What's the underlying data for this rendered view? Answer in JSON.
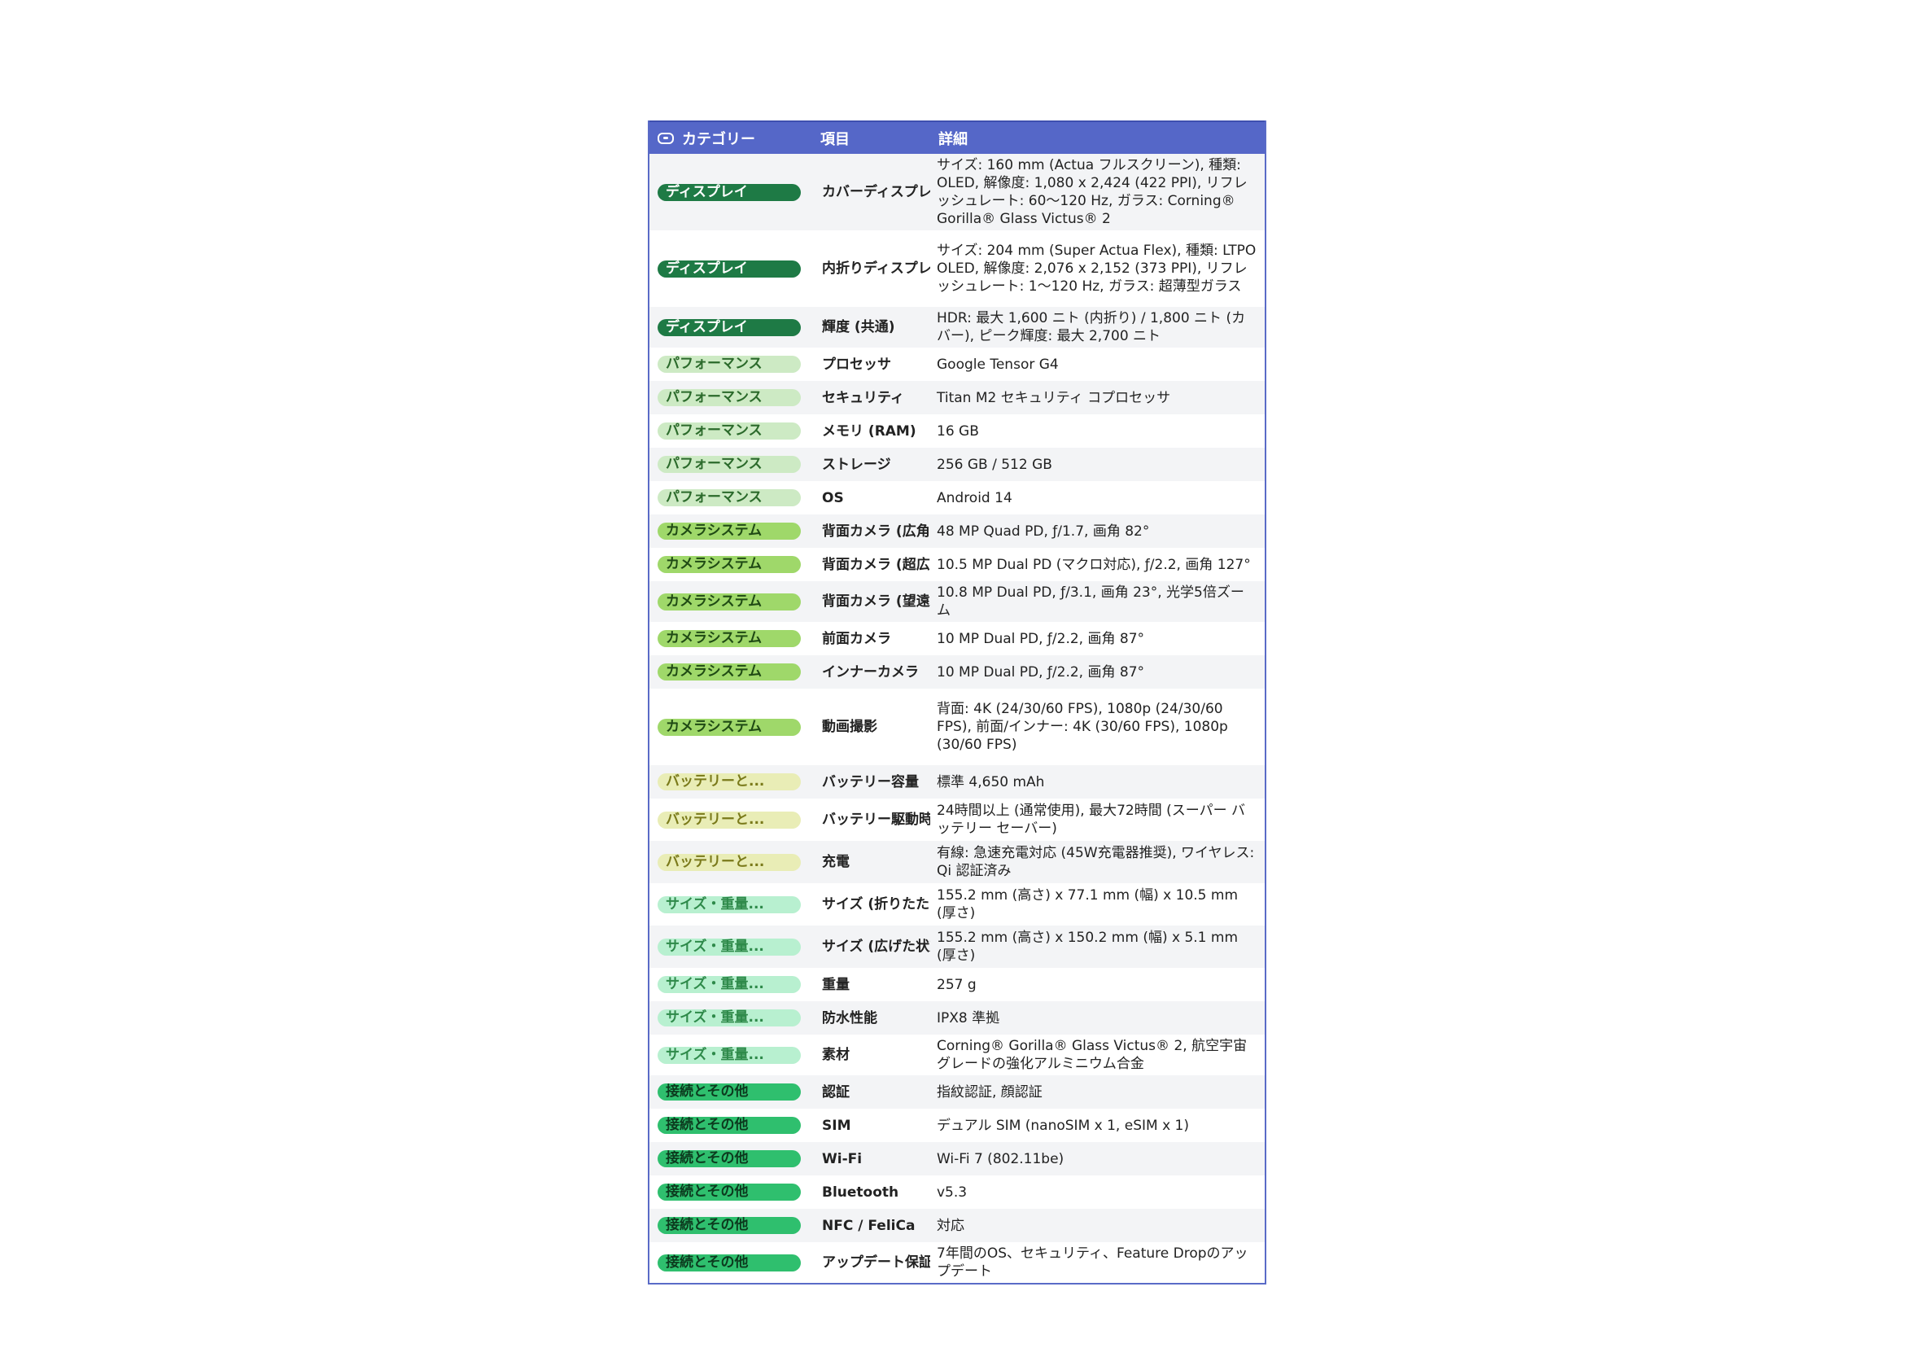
{
  "header": {
    "col_category": "カテゴリー",
    "col_item": "項目",
    "col_detail": "詳細"
  },
  "colors": {
    "header_bg": "#5567c8",
    "display": {
      "bg": "#1e7a45",
      "fg": "#ffffff"
    },
    "performance": {
      "bg": "#cdeac4",
      "fg": "#2b6a2b"
    },
    "camera": {
      "bg": "#9fd86a",
      "fg": "#1f4a14"
    },
    "battery": {
      "bg": "#e9edb6",
      "fg": "#7a7a1a"
    },
    "size": {
      "bg": "#b8f0d0",
      "fg": "#2e8a4a"
    },
    "connect": {
      "bg": "#2fbf6e",
      "fg": "#0c3a1e"
    }
  },
  "rows": [
    {
      "cat": "ディスプレイ",
      "tone": "display",
      "item": "カバーディスプレイ",
      "detail": "サイズ: 160 mm (Actua フルスクリーン), 種類: OLED, 解像度: 1,080 x 2,424 (422 PPI), リフレッシュレート: 60〜120 Hz, ガラス: Corning® Gorilla® Glass Victus® 2",
      "h": "tall-4"
    },
    {
      "cat": "ディスプレイ",
      "tone": "display",
      "item": "内折りディスプレイ",
      "detail": "サイズ: 204 mm (Super Actua Flex), 種類: LTPO OLED, 解像度: 2,076 x 2,152 (373 PPI), リフレッシュレート: 1〜120 Hz, ガラス: 超薄型ガラス",
      "h": "tall-3"
    },
    {
      "cat": "ディスプレイ",
      "tone": "display",
      "item": "輝度 (共通)",
      "detail": "HDR: 最大 1,600 ニト (内折り) / 1,800 ニト (カバー), ピーク輝度: 最大 2,700 ニト",
      "h": "tall-2b"
    },
    {
      "cat": "パフォーマンス",
      "tone": "performance",
      "item": "プロセッサ",
      "detail": "Google Tensor G4",
      "h": ""
    },
    {
      "cat": "パフォーマンス",
      "tone": "performance",
      "item": "セキュリティ",
      "detail": "Titan M2 セキュリティ コプロセッサ",
      "h": ""
    },
    {
      "cat": "パフォーマンス",
      "tone": "performance",
      "item": "メモリ (RAM)",
      "detail": "16 GB",
      "h": ""
    },
    {
      "cat": "パフォーマンス",
      "tone": "performance",
      "item": "ストレージ",
      "detail": "256 GB / 512 GB",
      "h": ""
    },
    {
      "cat": "パフォーマンス",
      "tone": "performance",
      "item": "OS",
      "detail": "Android 14",
      "h": ""
    },
    {
      "cat": "カメラシステム",
      "tone": "camera",
      "item": "背面カメラ (広角)",
      "detail": "48 MP Quad PD, ƒ/1.7, 画角 82°",
      "h": ""
    },
    {
      "cat": "カメラシステム",
      "tone": "camera",
      "item": "背面カメラ (超広角)",
      "detail": "10.5 MP Dual PD (マクロ対応), ƒ/2.2, 画角 127°",
      "h": ""
    },
    {
      "cat": "カメラシステム",
      "tone": "camera",
      "item": "背面カメラ (望遠)",
      "detail": "10.8 MP Dual PD, ƒ/3.1, 画角 23°, 光学5倍ズーム",
      "h": ""
    },
    {
      "cat": "カメラシステム",
      "tone": "camera",
      "item": "前面カメラ",
      "detail": "10 MP Dual PD, ƒ/2.2, 画角 87°",
      "h": ""
    },
    {
      "cat": "カメラシステム",
      "tone": "camera",
      "item": "インナーカメラ",
      "detail": "10 MP Dual PD, ƒ/2.2, 画角 87°",
      "h": ""
    },
    {
      "cat": "カメラシステム",
      "tone": "camera",
      "item": "動画撮影",
      "detail": "背面: 4K (24/30/60 FPS), 1080p (24/30/60 FPS), 前面/インナー: 4K (30/60 FPS), 1080p (30/60 FPS)",
      "h": "tall-4"
    },
    {
      "cat": "バッテリーと...",
      "tone": "battery",
      "item": "バッテリー容量",
      "detail": "標準 4,650 mAh",
      "h": ""
    },
    {
      "cat": "バッテリーと...",
      "tone": "battery",
      "item": "バッテリー駆動時間",
      "detail": "24時間以上 (通常使用), 最大72時間 (スーパー バッテリー セーバー)",
      "h": "tall-2"
    },
    {
      "cat": "バッテリーと...",
      "tone": "battery",
      "item": "充電",
      "detail": "有線: 急速充電対応 (45W充電器推奨), ワイヤレス: Qi 認証済み",
      "h": "tall-2"
    },
    {
      "cat": "サイズ・重量...",
      "tone": "size",
      "item": "サイズ (折りたたみ時)",
      "detail": "155.2 mm (高さ) x 77.1 mm (幅) x 10.5 mm (厚さ)",
      "h": "tall-2"
    },
    {
      "cat": "サイズ・重量...",
      "tone": "size",
      "item": "サイズ (広げた状態)",
      "detail": "155.2 mm (高さ) x 150.2 mm (幅) x 5.1 mm (厚さ)",
      "h": "tall-2"
    },
    {
      "cat": "サイズ・重量...",
      "tone": "size",
      "item": "重量",
      "detail": "257 g",
      "h": ""
    },
    {
      "cat": "サイズ・重量...",
      "tone": "size",
      "item": "防水性能",
      "detail": "IPX8 準拠",
      "h": ""
    },
    {
      "cat": "サイズ・重量...",
      "tone": "size",
      "item": "素材",
      "detail": "Corning® Gorilla® Glass Victus® 2, 航空宇宙グレードの強化アルミニウム合金",
      "h": "tall-2b"
    },
    {
      "cat": "接続とその他",
      "tone": "connect",
      "item": "認証",
      "detail": "指紋認証, 顔認証",
      "h": ""
    },
    {
      "cat": "接続とその他",
      "tone": "connect",
      "item": "SIM",
      "detail": "デュアル SIM (nanoSIM x 1, eSIM x 1)",
      "h": ""
    },
    {
      "cat": "接続とその他",
      "tone": "connect",
      "item": "Wi-Fi",
      "detail": "Wi-Fi 7 (802.11be)",
      "h": ""
    },
    {
      "cat": "接続とその他",
      "tone": "connect",
      "item": "Bluetooth",
      "detail": "v5.3",
      "h": ""
    },
    {
      "cat": "接続とその他",
      "tone": "connect",
      "item": "NFC / FeliCa",
      "detail": "対応",
      "h": ""
    },
    {
      "cat": "接続とその他",
      "tone": "connect",
      "item": "アップデート保証",
      "detail": "7年間のOS、セキュリティ、Feature Dropのアップデート",
      "h": "tall-2b"
    }
  ]
}
